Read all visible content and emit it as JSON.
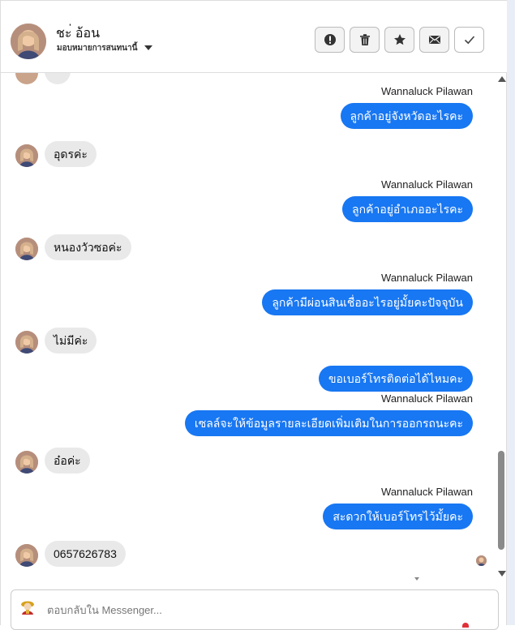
{
  "header": {
    "title": "ชะ่ อ้อน",
    "subtitle": "มอบหมายการสนทนานี้"
  },
  "toolbar": {
    "buttons": [
      {
        "name": "report-button",
        "icon": "alert-circle-icon"
      },
      {
        "name": "delete-button",
        "icon": "trash-icon"
      },
      {
        "name": "star-button",
        "icon": "star-icon"
      },
      {
        "name": "mail-button",
        "icon": "envelope-icon"
      },
      {
        "name": "done-button",
        "icon": "check-icon"
      }
    ]
  },
  "messages": [
    {
      "sender": "Wannaluck Pilawan",
      "text": "ลูกค้าอยู่จังหวัดอะไรคะ"
    },
    {
      "text": "อุดรค่ะ"
    },
    {
      "sender": "Wannaluck Pilawan",
      "text": "ลูกค้าอยู่อำเภออะไรคะ"
    },
    {
      "text": "หนองวัวซอค่ะ"
    },
    {
      "sender": "Wannaluck Pilawan",
      "text": "ลูกค้ามีผ่อนสินเชื่ออะไรอยู่มั้ยคะปัจจุบัน"
    },
    {
      "text": "ไม่มีค่ะ"
    },
    {
      "text": "ขอเบอร์โทรติดต่อได้ไหมคะ"
    },
    {
      "sender": "Wannaluck Pilawan",
      "text": "เซลล์จะให้ข้อมูลรายละเอียดเพิ่มเติมในการออกรถนะคะ"
    },
    {
      "text": "อ๋อค่ะ"
    },
    {
      "sender": "Wannaluck Pilawan",
      "text": "สะดวกให้เบอร์โทรไว้มั้ยคะ"
    },
    {
      "text": "0657626783"
    }
  ],
  "composer": {
    "placeholder": "ตอบกลับใน Messenger..."
  },
  "colors": {
    "outgoing": "#1877f2",
    "incoming": "#e9e9e9"
  }
}
